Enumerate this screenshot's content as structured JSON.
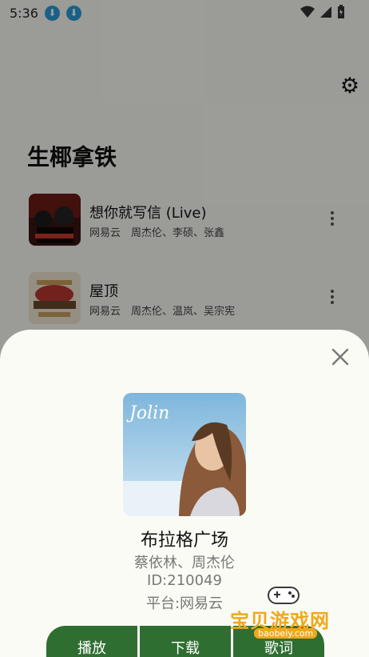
{
  "status_bar": {
    "time": "5:36"
  },
  "page": {
    "title": "生椰拿铁"
  },
  "songs": [
    {
      "title": "想你就写信 (Live)",
      "meta": "网易云　周杰伦、李硕、张鑫"
    },
    {
      "title": "屋顶",
      "meta": "网易云　周杰伦、温岚、吴宗宪"
    }
  ],
  "sheet": {
    "title": "布拉格广场",
    "artist": "蔡依林、周杰伦",
    "id": "ID:210049",
    "platform": "平台:网易云",
    "buttons": {
      "play": "播放",
      "download": "下载",
      "lyrics": "歌词"
    }
  },
  "watermark": {
    "brand": "宝贝游戏网",
    "url": "baobeiy.com"
  },
  "colors": {
    "accent": "#2f6e31",
    "status_icon": "#2a9bd8",
    "watermark": "#f0a81c"
  }
}
